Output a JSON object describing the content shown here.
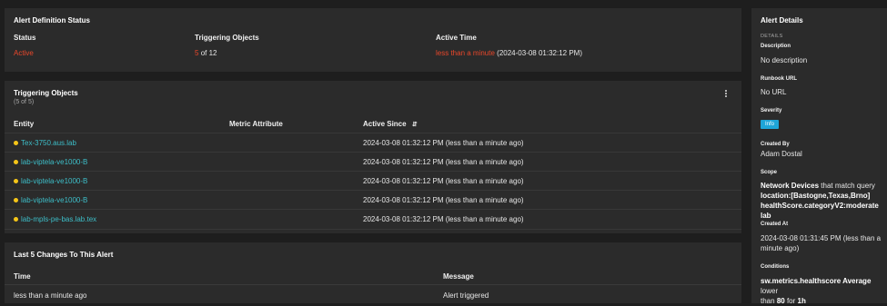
{
  "status_panel": {
    "title": "Alert Definition Status",
    "status_label": "Status",
    "status_value": "Active",
    "triggering_label": "Triggering Objects",
    "triggering_count": "5",
    "triggering_rest": "of 12",
    "active_time_label": "Active Time",
    "active_time_relative": "less than a minute",
    "active_time_absolute": "(2024-03-08 01:32:12 PM)"
  },
  "triggering_panel": {
    "title": "Triggering Objects",
    "subtitle": "(5 of 5)",
    "columns": {
      "entity": "Entity",
      "metric": "Metric Attribute",
      "since": "Active Since"
    },
    "rows": [
      {
        "entity": "Tex-3750.aus.lab",
        "since": "2024-03-08 01:32:12 PM (less than a minute ago)"
      },
      {
        "entity": "lab-viptela-ve1000-B",
        "since": "2024-03-08 01:32:12 PM (less than a minute ago)"
      },
      {
        "entity": "lab-viptela-ve1000-B",
        "since": "2024-03-08 01:32:12 PM (less than a minute ago)"
      },
      {
        "entity": "lab-viptela-ve1000-B",
        "since": "2024-03-08 01:32:12 PM (less than a minute ago)"
      },
      {
        "entity": "lab-mpls-pe-bas.lab.tex",
        "since": "2024-03-08 01:32:12 PM (less than a minute ago)"
      }
    ],
    "status_dot_color": "#f5c518"
  },
  "changes_panel": {
    "title": "Last 5 Changes To This Alert",
    "col_time": "Time",
    "col_message": "Message",
    "rows": [
      {
        "time": "less than a minute ago",
        "message": "Alert triggered"
      }
    ]
  },
  "details": {
    "title": "Alert Details",
    "section": "DETAILS",
    "description_label": "Description",
    "description": "No description",
    "runbook_label": "Runbook URL",
    "runbook": "No URL",
    "severity_label": "Severity",
    "severity": "Info",
    "created_by_label": "Created By",
    "created_by": "Adam Dostal",
    "scope_label": "Scope",
    "scope_entity": "Network Devices",
    "scope_rest": "that match query",
    "scope_query_1": "location:[Bastogne,Texas,Brno]",
    "scope_query_2": "healthScore.categoryV2:moderate lab",
    "created_at_label": "Created At",
    "created_at_1": "2024-03-08 01:31:45 PM (less than a",
    "created_at_2": "minute ago)",
    "conditions_label": "Conditions",
    "conditions_metric": "sw.metrics.healthscore Average",
    "conditions_rest": "lower",
    "conditions_2a": "than",
    "conditions_value": "80",
    "conditions_2b": "for",
    "conditions_duration": "1h"
  },
  "colors": {
    "accent": "#3dbec8",
    "active": "#e8472b",
    "badge": "#1ea5d8"
  }
}
